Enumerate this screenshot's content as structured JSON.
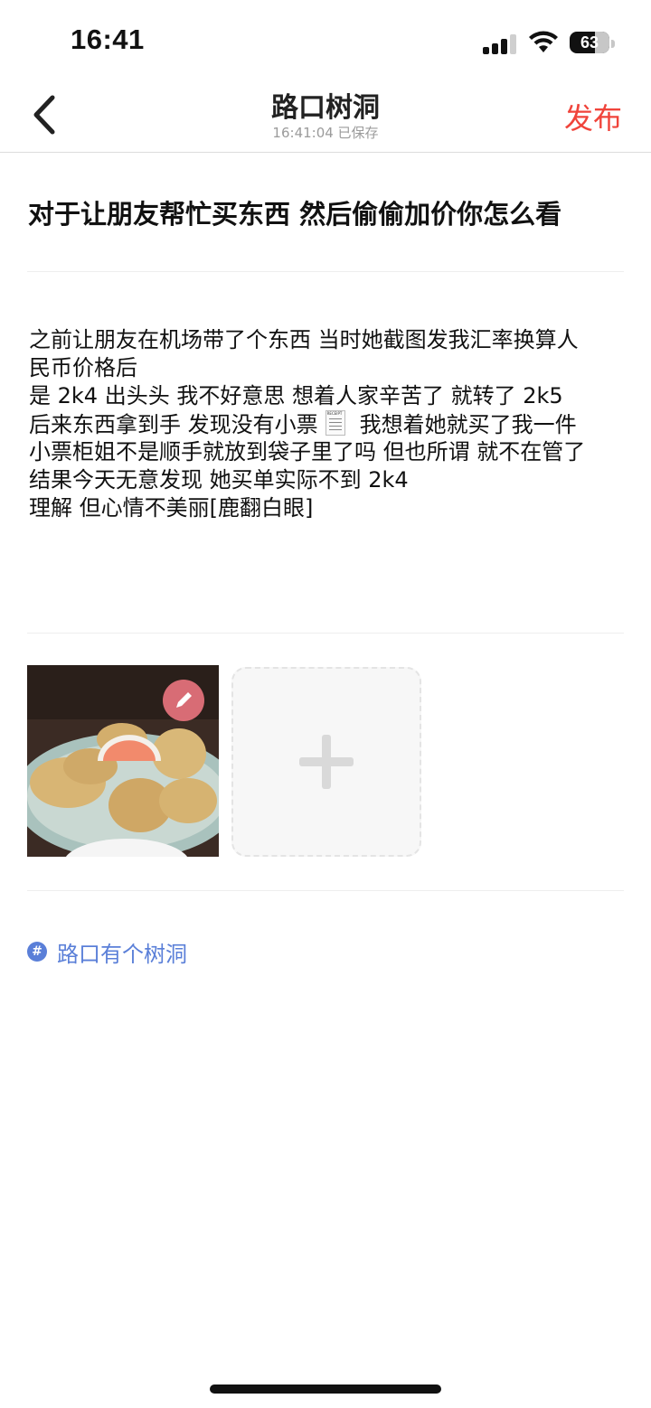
{
  "status_bar": {
    "time": "16:41",
    "battery": "63",
    "battery_level": 0.63,
    "icons": [
      "cellular-signal-icon",
      "wifi-icon",
      "battery-icon"
    ]
  },
  "nav": {
    "title": "路口树洞",
    "subtitle": "16:41:04 已保存",
    "publish_label": "发布",
    "back_icon": "chevron-left-icon"
  },
  "post": {
    "title": "对于让朋友帮忙买东西 然后偷偷加价你怎么看",
    "body_lines": [
      "之前让朋友在机场带了个东西 当时她截图发我汇率换算人",
      "民币价格后",
      "是 2k4 出头头 我不好意思 想着人家辛苦了 就转了 2k5",
      "后来东西拿到手 发现没有小票",
      "我想着她就买了我一件",
      "小票柜姐不是顺手就放到袋子里了吗 但也所谓 就不在管了",
      "结果今天无意发现 她买单实际不到 2k4",
      "理解 但心情不美丽[鹿翻白眼]"
    ],
    "emoji_receipt": "RECEIPT"
  },
  "images": {
    "photo_name": "food-photo",
    "edit_icon": "pencil-icon",
    "add_icon": "plus-icon"
  },
  "topic": {
    "label": "路口有个树洞",
    "icon": "hashtag-icon",
    "hash": "#"
  },
  "colors": {
    "accent_red": "#f0443b",
    "topic_blue": "#5a7fd8"
  }
}
